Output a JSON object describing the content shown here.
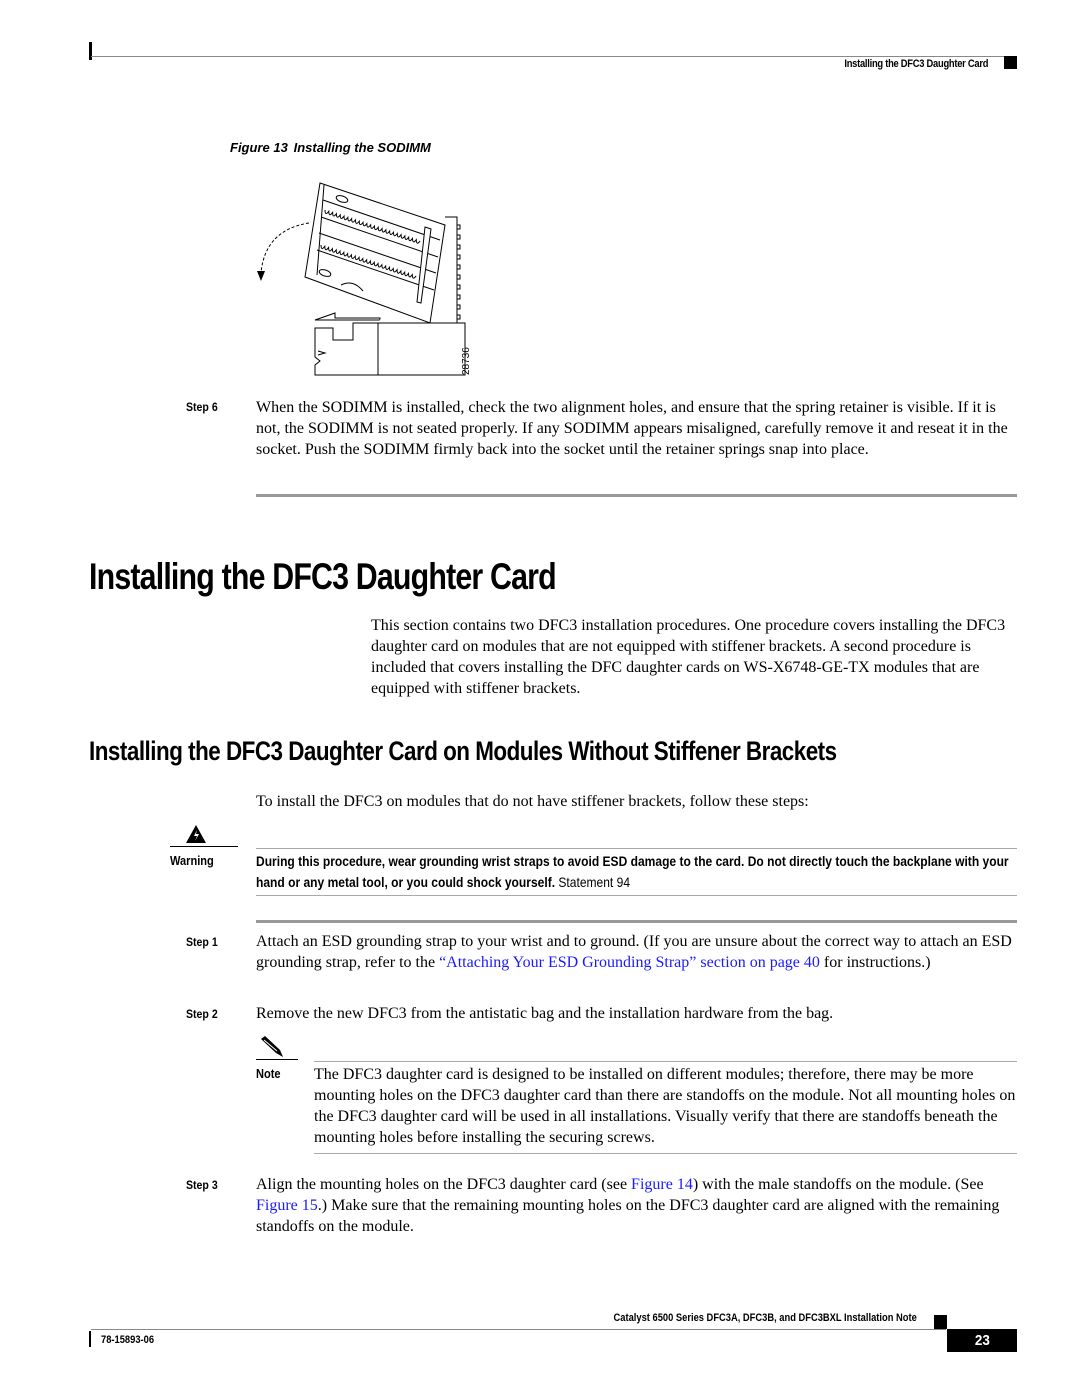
{
  "header": {
    "running_title": "Installing the DFC3 Daughter Card"
  },
  "figure13": {
    "number_label": "Figure 13",
    "caption": "Installing the SODIMM",
    "art_id": "28736"
  },
  "step6": {
    "label": "Step 6",
    "text": "When the SODIMM is installed, check the two alignment holes, and ensure that the spring retainer is visible. If it is not, the SODIMM is not seated properly. If any SODIMM appears misaligned, carefully remove it and reseat it in the socket. Push the SODIMM firmly back into the socket until the retainer springs snap into place."
  },
  "section": {
    "heading": "Installing the DFC3 Daughter Card",
    "intro": "This section contains two DFC3 installation procedures. One procedure covers installing the DFC3 daughter card on modules that are not equipped with stiffener brackets. A second procedure is included that covers installing the DFC daughter cards on WS-X6748-GE-TX modules that are equipped with stiffener brackets."
  },
  "subsection": {
    "heading": "Installing the DFC3 Daughter Card on Modules Without Stiffener Brackets",
    "lead": "To install the DFC3 on modules that do not have stiffener brackets, follow these steps:"
  },
  "warning": {
    "icon": "warning-triangle-icon",
    "label": "Warning",
    "text": "During this procedure, wear grounding wrist straps to avoid ESD damage to the card. Do not directly touch the backplane with your hand or any metal tool, or you could shock yourself.",
    "statement": " Statement 94"
  },
  "steps": [
    {
      "label": "Step 1",
      "text_before": "Attach an ESD grounding strap to your wrist and to ground. (If you are unsure about the correct way to attach an ESD grounding strap, refer to the ",
      "link": "“Attaching Your ESD Grounding Strap” section on page 40",
      "text_after": " for instructions.)"
    },
    {
      "label": "Step 2",
      "text": "Remove the new DFC3 from the antistatic bag and the installation hardware from the bag."
    },
    {
      "label": "Step 3",
      "text_1": "Align the mounting holes on the DFC3 daughter card (see ",
      "link_1": "Figure 14",
      "text_2": ") with the male standoffs on the module. (See ",
      "link_2": "Figure 15",
      "text_3": ".) Make sure that the remaining mounting holes on the DFC3 daughter card are aligned with the remaining standoffs on the module."
    }
  ],
  "note": {
    "icon": "pencil-note-icon",
    "label": "Note",
    "text": "The DFC3 daughter card is designed to be installed on different modules; therefore, there may be more mounting holes on the DFC3 daughter card than there are standoffs on the module. Not all mounting holes on the DFC3 daughter card will be used in all installations. Visually verify that there are standoffs beneath the mounting holes before installing the securing screws."
  },
  "footer": {
    "doc_title": "Catalyst 6500 Series DFC3A, DFC3B, and DFC3BXL Installation Note",
    "doc_number": "78-15893-06",
    "page_number": "23"
  },
  "colors": {
    "link": "#1a1aff",
    "rule": "#999999"
  }
}
